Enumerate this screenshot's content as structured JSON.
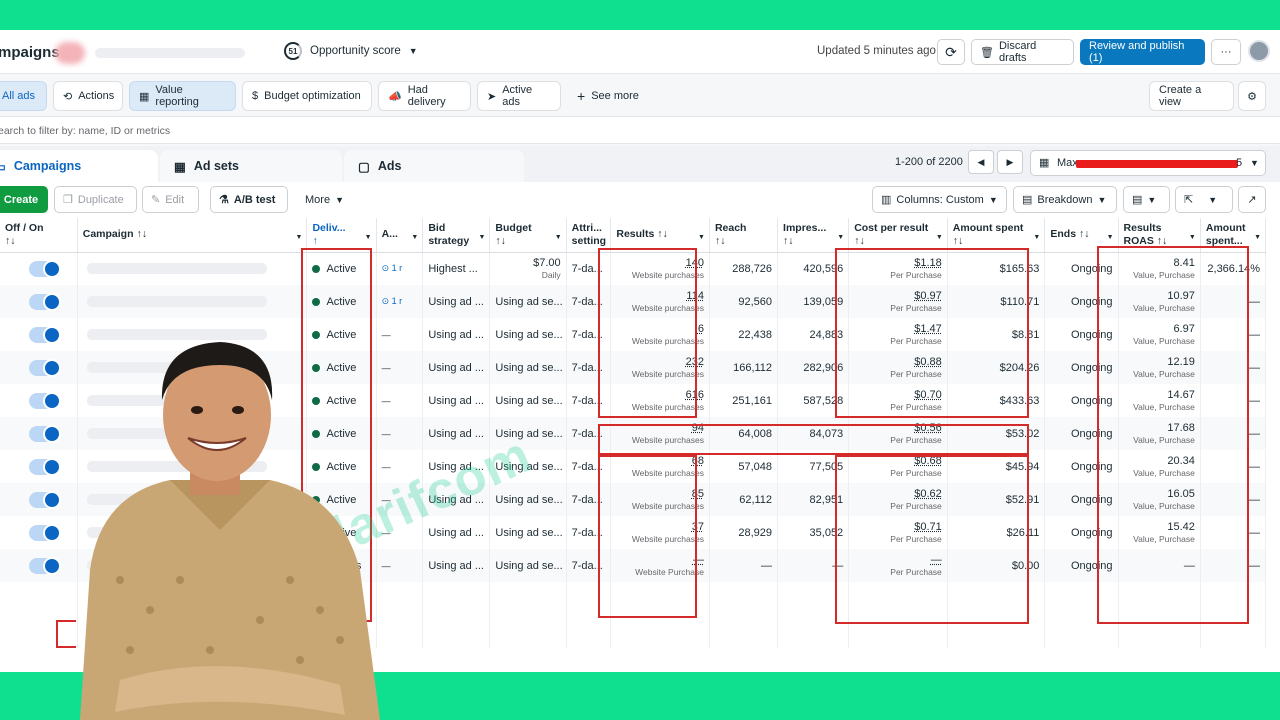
{
  "header": {
    "title": "mpaigns",
    "opportunity_score": "51",
    "opportunity_label": "Opportunity score",
    "updated": "Updated 5 minutes ago",
    "discard": "Discard drafts",
    "publish": "Review and publish (1)",
    "more": "···"
  },
  "filters": {
    "all_ads": "All ads",
    "actions": "Actions",
    "value_reporting": "Value reporting",
    "budget_optimization": "Budget optimization",
    "had_delivery": "Had delivery",
    "active_ads": "Active ads",
    "see_more": "See more",
    "create_view": "Create a view"
  },
  "search": {
    "placeholder": "earch to filter by: name, ID or metrics"
  },
  "tabs": {
    "campaigns": "Campaigns",
    "adsets": "Ad sets",
    "ads": "Ads"
  },
  "pager": {
    "range": "1-200 of 2200",
    "date_prefix": "Max",
    "date_suffix": "5"
  },
  "toolbar": {
    "create": "Create",
    "duplicate": "Duplicate",
    "edit": "Edit",
    "ab_test": "A/B test",
    "more": "More",
    "columns": "Columns: Custom",
    "breakdown": "Breakdown"
  },
  "columns": {
    "offon": "Off / On",
    "campaign": "Campaign",
    "delivery": "Deliv...",
    "a": "A...",
    "bid": "Bid strategy",
    "bid_1": "Bid",
    "bid_2": "strategy",
    "budget": "Budget",
    "attr_1": "Attri...",
    "attr_2": "setting",
    "results": "Results",
    "reach": "Reach",
    "impressions": "Impres...",
    "cpr": "Cost per result",
    "amount": "Amount spent",
    "ends": "Ends",
    "roas_1": "Results",
    "roas_2": "ROAS",
    "amount2_1": "Amount",
    "amount2_2": "spent..."
  },
  "rows": [
    {
      "delivery": "Active",
      "a": "1 r",
      "bid": "Highest ...",
      "budget": "$7.00",
      "budget_sub": "Daily",
      "attr": "7-da...",
      "results": "140",
      "results_sub": "Website purchases",
      "reach": "288,726",
      "impressions": "420,596",
      "cpr": "$1.18",
      "cpr_sub": "Per Purchase",
      "amount": "$165.63",
      "ends": "Ongoing",
      "roas": "8.41",
      "roas_sub": "Value, Purchase",
      "amount2": "2,366.14%"
    },
    {
      "delivery": "Active",
      "a": "1 r",
      "bid": "Using ad ...",
      "budget": "Using ad se...",
      "budget_sub": "",
      "attr": "7-da...",
      "results": "114",
      "results_sub": "Website purchases",
      "reach": "92,560",
      "impressions": "139,059",
      "cpr": "$0.97",
      "cpr_sub": "Per Purchase",
      "amount": "$110.71",
      "ends": "Ongoing",
      "roas": "10.97",
      "roas_sub": "Value, Purchase",
      "amount2": "—"
    },
    {
      "delivery": "Active",
      "a": "—",
      "bid": "Using ad ...",
      "budget": "Using ad se...",
      "budget_sub": "",
      "attr": "7-da...",
      "results": "6",
      "results_sub": "Website purchases",
      "reach": "22,438",
      "impressions": "24,883",
      "cpr": "$1.47",
      "cpr_sub": "Per Purchase",
      "amount": "$8.81",
      "ends": "Ongoing",
      "roas": "6.97",
      "roas_sub": "Value, Purchase",
      "amount2": "—"
    },
    {
      "delivery": "Active",
      "a": "—",
      "bid": "Using ad ...",
      "budget": "Using ad se...",
      "budget_sub": "",
      "attr": "7-da...",
      "results": "232",
      "results_sub": "Website purchases",
      "reach": "166,112",
      "impressions": "282,906",
      "cpr": "$0.88",
      "cpr_sub": "Per Purchase",
      "amount": "$204.26",
      "ends": "Ongoing",
      "roas": "12.19",
      "roas_sub": "Value, Purchase",
      "amount2": "—"
    },
    {
      "delivery": "Active",
      "a": "—",
      "bid": "Using ad ...",
      "budget": "Using ad se...",
      "budget_sub": "",
      "attr": "7-da...",
      "results": "616",
      "results_sub": "Website purchases",
      "reach": "251,161",
      "impressions": "587,528",
      "cpr": "$0.70",
      "cpr_sub": "Per Purchase",
      "amount": "$433.63",
      "ends": "Ongoing",
      "roas": "14.67",
      "roas_sub": "Value, Purchase",
      "amount2": "—"
    },
    {
      "delivery": "Active",
      "a": "—",
      "bid": "Using ad ...",
      "budget": "Using ad se...",
      "budget_sub": "",
      "attr": "7-da...",
      "results": "94",
      "results_sub": "Website purchases",
      "reach": "64,008",
      "impressions": "84,073",
      "cpr": "$0.56",
      "cpr_sub": "Per Purchase",
      "amount": "$53.02",
      "ends": "Ongoing",
      "roas": "17.68",
      "roas_sub": "Value, Purchase",
      "amount2": "—"
    },
    {
      "delivery": "Active",
      "a": "—",
      "bid": "Using ad ...",
      "budget": "Using ad se...",
      "budget_sub": "",
      "attr": "7-da...",
      "results": "68",
      "results_sub": "Website purchases",
      "reach": "57,048",
      "impressions": "77,505",
      "cpr": "$0.68",
      "cpr_sub": "Per Purchase",
      "amount": "$45.94",
      "ends": "Ongoing",
      "roas": "20.34",
      "roas_sub": "Value, Purchase",
      "amount2": "—"
    },
    {
      "delivery": "Active",
      "a": "—",
      "bid": "Using ad ...",
      "budget": "Using ad se...",
      "budget_sub": "",
      "attr": "7-da...",
      "results": "85",
      "results_sub": "Website purchases",
      "reach": "62,112",
      "impressions": "82,951",
      "cpr": "$0.62",
      "cpr_sub": "Per Purchase",
      "amount": "$52.91",
      "ends": "Ongoing",
      "roas": "16.05",
      "roas_sub": "Value, Purchase",
      "amount2": "—"
    },
    {
      "delivery": "Active",
      "a": "—",
      "bid": "Using ad ...",
      "budget": "Using ad se...",
      "budget_sub": "",
      "attr": "7-da...",
      "results": "37",
      "results_sub": "Website purchases",
      "reach": "28,929",
      "impressions": "35,052",
      "cpr": "$0.71",
      "cpr_sub": "Per Purchase",
      "amount": "$26.11",
      "ends": "Ongoing",
      "roas": "15.42",
      "roas_sub": "Value, Purchase",
      "amount2": "—"
    },
    {
      "delivery": "No ads",
      "a": "—",
      "bid": "Using ad ...",
      "budget": "Using ad se...",
      "budget_sub": "",
      "attr": "7-da...",
      "results": "—",
      "results_sub": "Website Purchase",
      "reach": "—",
      "impressions": "—",
      "cpr": "—",
      "cpr_sub": "Per Purchase",
      "amount": "$0.00",
      "ends": "Ongoing",
      "roas": "—",
      "roas_sub": "",
      "amount2": "—"
    }
  ],
  "watermark": "mdarifcom",
  "colors": {
    "accent": "#0a66c2",
    "publish": "#0a78be",
    "create": "#0f9b3f",
    "highlight": "#d42a2a",
    "frame": "#0fe08f"
  }
}
